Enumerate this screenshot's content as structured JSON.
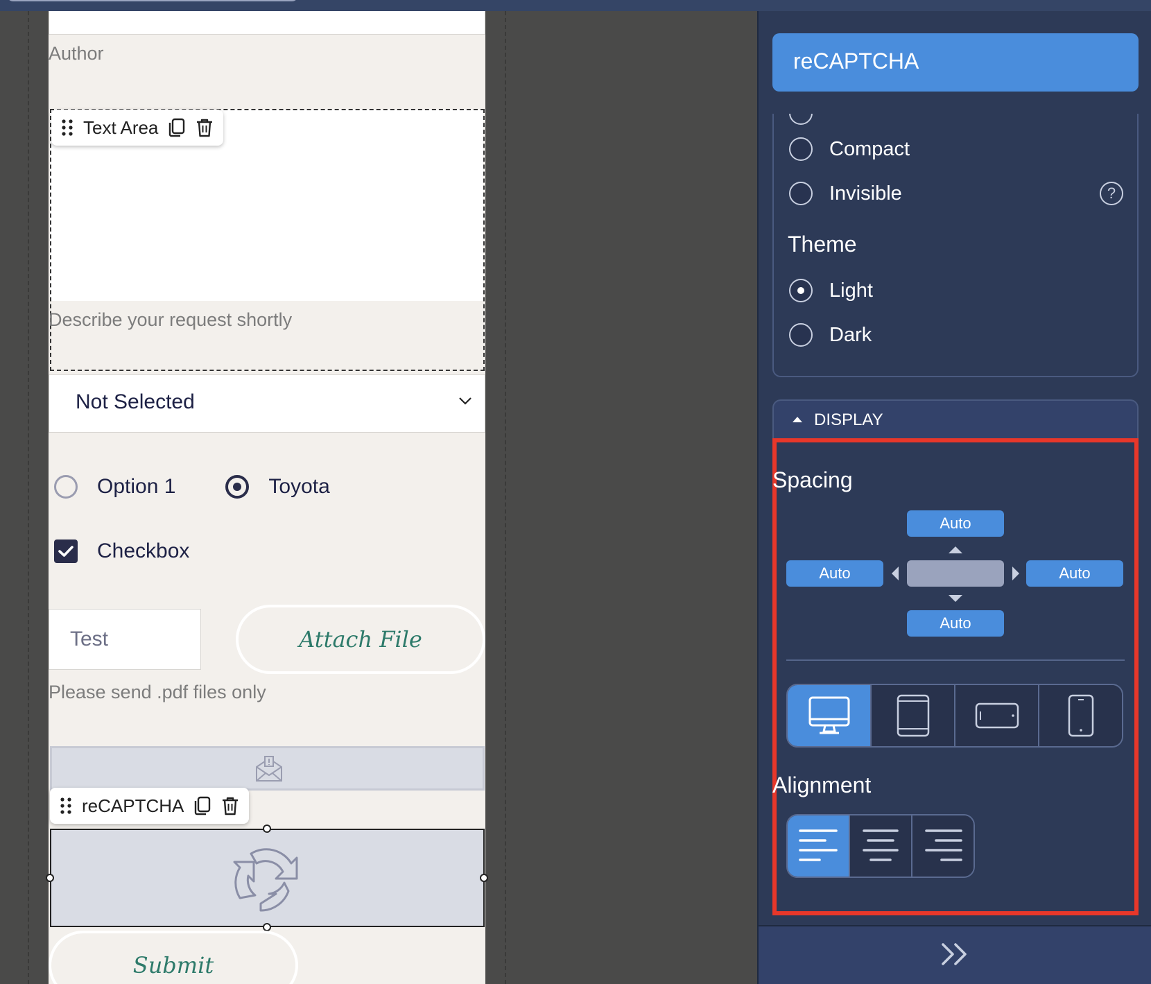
{
  "canvas": {
    "author_helper": "Author",
    "text_area_chip": {
      "label": "Text Area"
    },
    "text_area_helper": "Describe your request shortly",
    "select": {
      "value": "Not Selected"
    },
    "radios": [
      {
        "label": "Option 1",
        "selected": false
      },
      {
        "label": "Toyota",
        "selected": true
      }
    ],
    "checkbox": {
      "label": "Checkbox",
      "checked": true
    },
    "test_input": {
      "value": "Test"
    },
    "attach_button": "Attach File",
    "attach_helper": "Please send .pdf files only",
    "recaptcha_chip": {
      "label": "reCAPTCHA"
    },
    "submit_button": "Submit"
  },
  "panel": {
    "header_title": "reCAPTCHA",
    "size_options": [
      {
        "label": "Compact",
        "selected": false
      },
      {
        "label": "Invisible",
        "selected": false
      }
    ],
    "help_glyph": "?",
    "theme_heading": "Theme",
    "theme_options": [
      {
        "label": "Light",
        "selected": true
      },
      {
        "label": "Dark",
        "selected": false
      }
    ],
    "display_section": "DISPLAY",
    "spacing_heading": "Spacing",
    "spacing": {
      "top": "Auto",
      "left": "Auto",
      "right": "Auto",
      "bottom": "Auto"
    },
    "devices": [
      "desktop-icon",
      "tablet-icon",
      "tablet-landscape-icon",
      "mobile-icon"
    ],
    "active_device": "desktop-icon",
    "alignment_heading": "Alignment",
    "alignments": [
      "align-left-icon",
      "align-center-icon",
      "align-right-icon"
    ],
    "active_alignment": "align-left-icon"
  },
  "colors": {
    "accent": "#4a8ddc",
    "panel_bg": "#2d3a57",
    "highlight": "#e8372a",
    "button_text": "#2d7a6a"
  }
}
